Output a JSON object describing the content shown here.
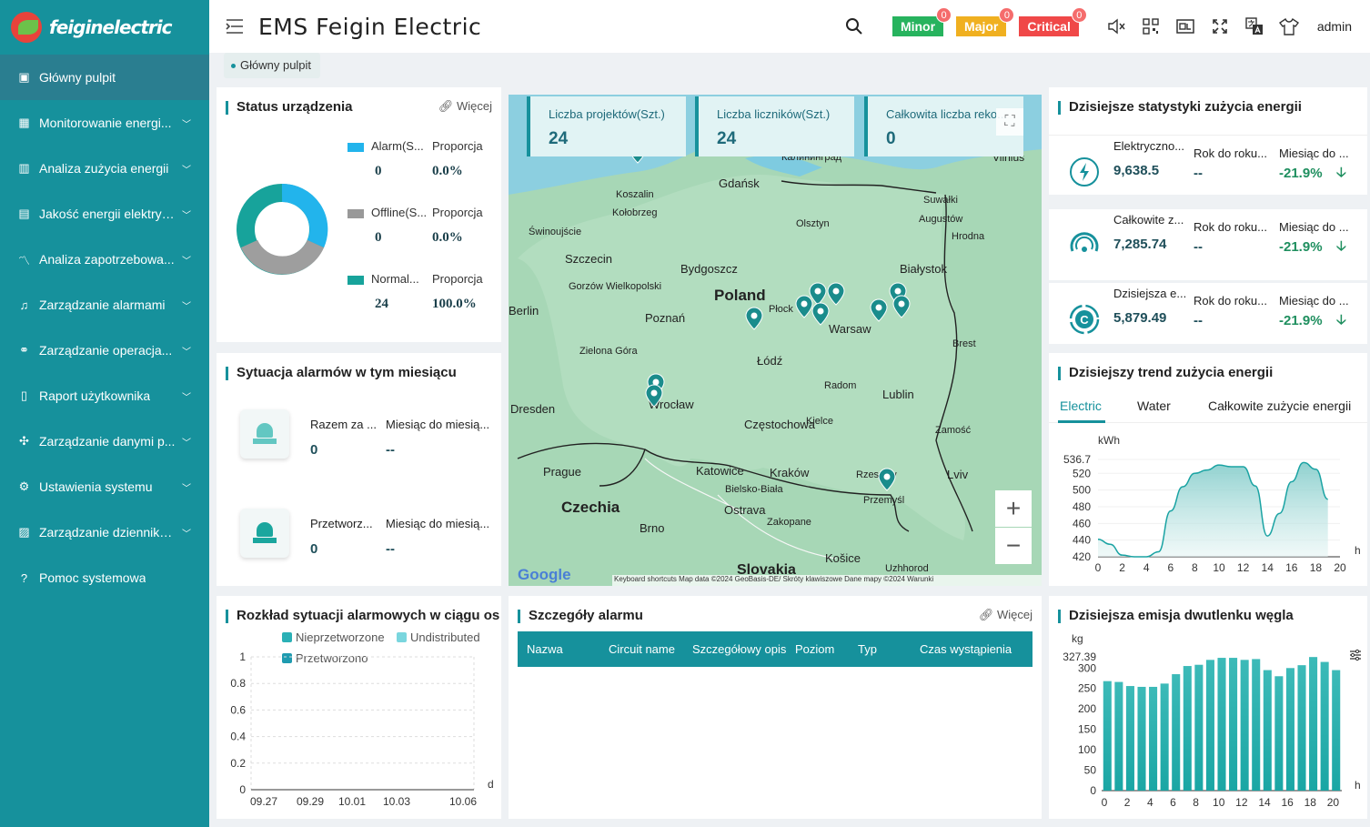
{
  "brand": {
    "logo_text": "feiginelectric",
    "app_title": "EMS Feigin Electric"
  },
  "sidebar": {
    "items": [
      {
        "label": "Główny pulpit",
        "icon": "dashboard-icon",
        "active": true
      },
      {
        "label": "Monitorowanie energi...",
        "icon": "monitor-icon"
      },
      {
        "label": "Analiza zużycia energii",
        "icon": "bar-chart-icon"
      },
      {
        "label": "Jakość energii elektryc...",
        "icon": "power-quality-icon"
      },
      {
        "label": "Analiza zapotrzebowa...",
        "icon": "trend-icon"
      },
      {
        "label": "Zarządzanie alarmami",
        "icon": "bell-icon"
      },
      {
        "label": "Zarządzanie operacja...",
        "icon": "operation-icon"
      },
      {
        "label": "Raport użytkownika",
        "icon": "report-icon"
      },
      {
        "label": "Zarządzanie danymi p...",
        "icon": "data-icon"
      },
      {
        "label": "Ustawienia systemu",
        "icon": "settings-icon"
      },
      {
        "label": "Zarządzanie dziennika...",
        "icon": "log-icon"
      },
      {
        "label": "Pomoc systemowa",
        "icon": "help-icon"
      }
    ]
  },
  "header": {
    "alarms": [
      {
        "label": "Minor",
        "count": "0",
        "color": "#27b35e"
      },
      {
        "label": "Major",
        "count": "0",
        "color": "#f0b020"
      },
      {
        "label": "Critical",
        "count": "0",
        "color": "#f04848"
      }
    ],
    "user": "admin"
  },
  "breadcrumb": {
    "tag": "Główny pulpit"
  },
  "device_status": {
    "title": "Status urządzenia",
    "more": "Więcej",
    "rows": [
      {
        "name": "Alarm(S...",
        "ratio_label": "Proporcja",
        "count": "0",
        "ratio": "0.0%",
        "color": "#22b4ec"
      },
      {
        "name": "Offline(S...",
        "ratio_label": "Proporcja",
        "count": "0",
        "ratio": "0.0%",
        "color": "#999999"
      },
      {
        "name": "Normal...",
        "ratio_label": "Proporcja",
        "count": "24",
        "ratio": "100.0%",
        "color": "#17a39b"
      }
    ]
  },
  "alarm_month": {
    "title": "Sytuacja alarmów w tym miesiącu",
    "rows": [
      {
        "label": "Razem za ...",
        "value": "0",
        "mom_label": "Miesiąc do miesią...",
        "mom": "--"
      },
      {
        "label": "Przetworz...",
        "value": "0",
        "mom_label": "Miesiąc do miesią...",
        "mom": "--"
      }
    ]
  },
  "map": {
    "cards": [
      {
        "label": "Liczba projektów(Szt.)",
        "value": "24"
      },
      {
        "label": "Liczba liczników(Szt.)",
        "value": "24"
      },
      {
        "label": "Całkowita liczba reko...",
        "value": "0"
      }
    ],
    "places": [
      "Gdańsk",
      "Koszalin",
      "Kołobrzeg",
      "Szczecin",
      "Świnoujście",
      "Bydgoszcz",
      "Poland",
      "Poznań",
      "Olsztyn",
      "Białystok",
      "Płock",
      "Warsaw",
      "Łódź",
      "Zielona Góra",
      "Gorzów Wielkopolski",
      "Wrocław",
      "Częstochowa",
      "Kielce",
      "Radom",
      "Lublin",
      "Zamość",
      "Katowice",
      "Kraków",
      "Rzeszów",
      "Przemyśl",
      "Lviv",
      "Prague",
      "Czechia",
      "Brno",
      "Ostrava",
      "Bielsko-Biała",
      "Zakopane",
      "Slovakia",
      "Košice",
      "Uzhhorod",
      "Dresden",
      "Berlin",
      "Brest",
      "Hrodna",
      "Suwałki",
      "Augustów",
      "Vilnius",
      "Калининград",
      "Kielce"
    ],
    "attribution": "Keyboard shortcuts   Map data ©2024 GeoBasis-DE/ Skróty klawiszowe   Dane mapy ©2024   Warunki",
    "google": "Google"
  },
  "energy_stats": {
    "title": "Dzisiejsze statystyki zużycia energii",
    "rows": [
      {
        "label": "Elektryczno...",
        "value": "9,638.5",
        "yoy_label": "Rok do roku...",
        "yoy": "--",
        "mom_label": "Miesiąc do ...",
        "mom": "-21.9%",
        "icon": "lightning-icon"
      },
      {
        "label": "Całkowite z...",
        "value": "7,285.74",
        "yoy_label": "Rok do roku...",
        "yoy": "--",
        "mom_label": "Miesiąc do ...",
        "mom": "-21.9%",
        "icon": "gauge-icon"
      },
      {
        "label": "Dzisiejsza e...",
        "value": "5,879.49",
        "yoy_label": "Rok do roku...",
        "yoy": "--",
        "mom_label": "Miesiąc do ...",
        "mom": "-21.9%",
        "icon": "carbon-icon"
      }
    ]
  },
  "trend": {
    "title": "Dzisiejszy trend zużycia energii",
    "tabs": [
      "Electric",
      "Water",
      "Całkowite zużycie energii"
    ],
    "chart_data": {
      "type": "area",
      "ylabel": "kWh",
      "xlabel": "h",
      "x": [
        0,
        1,
        2,
        3,
        4,
        5,
        6,
        7,
        8,
        9,
        10,
        11,
        12,
        13,
        14,
        15,
        16,
        17,
        18,
        19
      ],
      "values": [
        441,
        435,
        422,
        420,
        420,
        426,
        475,
        504,
        520,
        524,
        530,
        528,
        528,
        505,
        445,
        472,
        510,
        533,
        525,
        489
      ],
      "ylim": [
        420,
        536.7
      ],
      "yticks": [
        "536.7",
        "520",
        "500",
        "480",
        "460",
        "440",
        "420"
      ],
      "xticks": [
        "0",
        "2",
        "4",
        "6",
        "8",
        "10",
        "12",
        "14",
        "16",
        "18",
        "20"
      ]
    }
  },
  "alarm_distribution": {
    "title": "Rozkład sytuacji alarmowych w ciągu os",
    "legend": [
      {
        "name": "Nieprzetworzone",
        "color": "#2bb0b6"
      },
      {
        "name": "Undistributed",
        "color": "#7ad6de"
      },
      {
        "name": "Przetworzono",
        "color": "#1f9bb0"
      }
    ],
    "chart_data": {
      "type": "bar",
      "xlabel": "d",
      "yticks": [
        "1",
        "0.8",
        "0.6",
        "0.4",
        "0.2",
        "0"
      ],
      "xticks": [
        "09.27",
        "09.29",
        "10.01",
        "10.03",
        "10.06"
      ],
      "ylim": [
        0,
        1
      ],
      "values": []
    }
  },
  "alarm_details": {
    "title": "Szczegóły alarmu",
    "more": "Więcej",
    "columns": [
      "Nazwa",
      "Circuit name",
      "Szczegółowy opis",
      "Poziom",
      "Typ",
      "Czas wystąpienia"
    ]
  },
  "co2": {
    "title": "Dzisiejsza emisja dwutlenku węgla",
    "chart_data": {
      "type": "bar",
      "ylabel": "kg",
      "xlabel": "h",
      "ylim": [
        0,
        327.39
      ],
      "yticks": [
        "327.39",
        "300",
        "250",
        "200",
        "150",
        "100",
        "50",
        "0"
      ],
      "xticks": [
        "0",
        "2",
        "4",
        "6",
        "8",
        "10",
        "12",
        "14",
        "16",
        "18",
        "20"
      ],
      "values": [
        268,
        266,
        256,
        254,
        254,
        262,
        285,
        305,
        308,
        320,
        325,
        325,
        320,
        322,
        295,
        280,
        300,
        307,
        327,
        315,
        295
      ]
    }
  }
}
